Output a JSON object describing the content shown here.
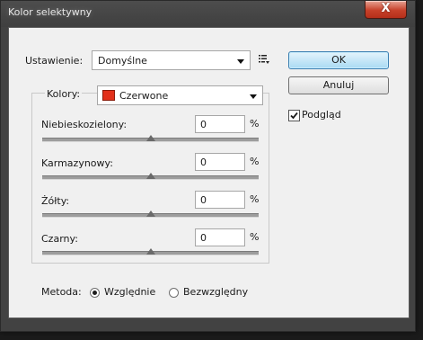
{
  "window": {
    "title": "Kolor selektywny",
    "close_glyph": "X"
  },
  "preset": {
    "label": "Ustawienie:",
    "value": "Domyślne",
    "menu_icon": "preset-options-icon"
  },
  "buttons": {
    "ok": "OK",
    "cancel": "Anuluj"
  },
  "preview": {
    "label": "Podgląd",
    "checked": true
  },
  "colors": {
    "label": "Kolory:",
    "value": "Czerwone",
    "swatch": "#e2301a"
  },
  "sliders": [
    {
      "label": "Niebieskozielony:",
      "value": "0",
      "unit": "%",
      "position": 0.5
    },
    {
      "label": "Karmazynowy:",
      "value": "0",
      "unit": "%",
      "position": 0.5
    },
    {
      "label": "Żółty:",
      "value": "0",
      "unit": "%",
      "position": 0.5
    },
    {
      "label": "Czarny:",
      "value": "0",
      "unit": "%",
      "position": 0.5
    }
  ],
  "method": {
    "label": "Metoda:",
    "options": [
      {
        "label": "Względnie",
        "selected": true
      },
      {
        "label": "Bezwzględny",
        "selected": false
      }
    ]
  }
}
